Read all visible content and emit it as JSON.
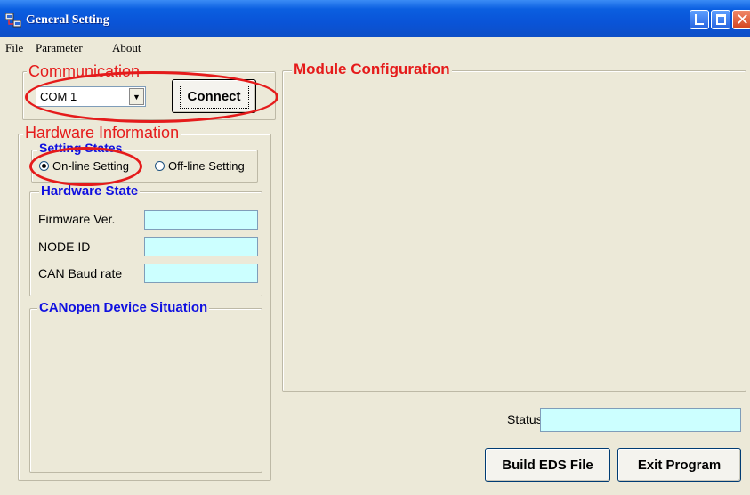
{
  "window": {
    "title": "General Setting",
    "icon": "app-icon"
  },
  "menu": [
    "File",
    "Parameter",
    "About"
  ],
  "communication": {
    "legend": "Communication",
    "port_value": "COM 1",
    "connect_label": "Connect"
  },
  "hardware_info": {
    "legend": "Hardware Information",
    "setting_states": {
      "legend": "Setting States",
      "online_label": "On-line Setting",
      "offline_label": "Off-line Setting",
      "selected": "online"
    },
    "hardware_state": {
      "legend": "Hardware State",
      "firmware_label": "Firmware Ver.",
      "firmware_value": "",
      "node_id_label": "NODE ID",
      "node_id_value": "",
      "baud_label": "CAN Baud rate",
      "baud_value": ""
    },
    "canopen": {
      "legend": "CANopen Device Situation"
    }
  },
  "module_config": {
    "legend": "Module Configuration"
  },
  "status": {
    "label": "Status:",
    "value": ""
  },
  "buttons": {
    "build_eds": "Build EDS File",
    "exit": "Exit Program"
  },
  "colors": {
    "annotation_red": "#e51b1b",
    "legend_blue": "#1010e0",
    "field_bg": "#ccffff",
    "window_bg": "#ece9d8"
  }
}
